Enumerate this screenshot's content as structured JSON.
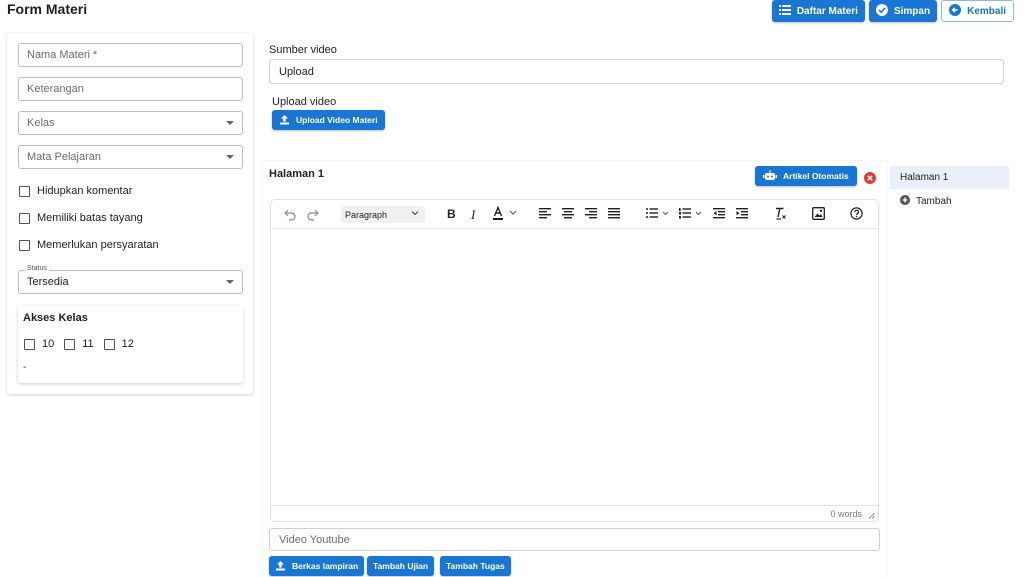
{
  "header": {
    "title": "Form Materi",
    "buttons": {
      "daftar": "Daftar Materi",
      "simpan": "Simpan",
      "kembali": "Kembali"
    }
  },
  "left": {
    "nama_placeholder": "Nama Materi *",
    "keterangan_placeholder": "Keterangan",
    "kelas_placeholder": "Kelas",
    "mapel_placeholder": "Mata Pelajaran",
    "checks": [
      "Hidupkan komentar",
      "Memiliki batas tayang",
      "Memerlukan persyaratan"
    ],
    "status_label": "Status",
    "status_value": "Tersedia",
    "akses_title": "Akses Kelas",
    "akses_options": [
      "10",
      "11",
      "12"
    ],
    "akses_note": "-"
  },
  "main": {
    "sumber_label": "Sumber video",
    "sumber_value": "Upload",
    "upload_label": "Upload video",
    "upload_button": "Upload Video Materi",
    "page_title": "Halaman 1",
    "artikel_button": "Artikel Otomatis",
    "block_format": "Paragraph",
    "word_count": "0 words",
    "youtube_placeholder": "Video Youtube",
    "bottom_buttons": {
      "berkas": "Berkas lampiran",
      "ujian": "Tambah Ujian",
      "tugas": "Tambah Tugas"
    }
  },
  "pages_panel": {
    "items": [
      "Halaman 1"
    ],
    "add_label": "Tambah"
  },
  "colors": {
    "primary": "#1976d2",
    "danger": "#e53935",
    "selected_bg": "#eaf0f9"
  }
}
